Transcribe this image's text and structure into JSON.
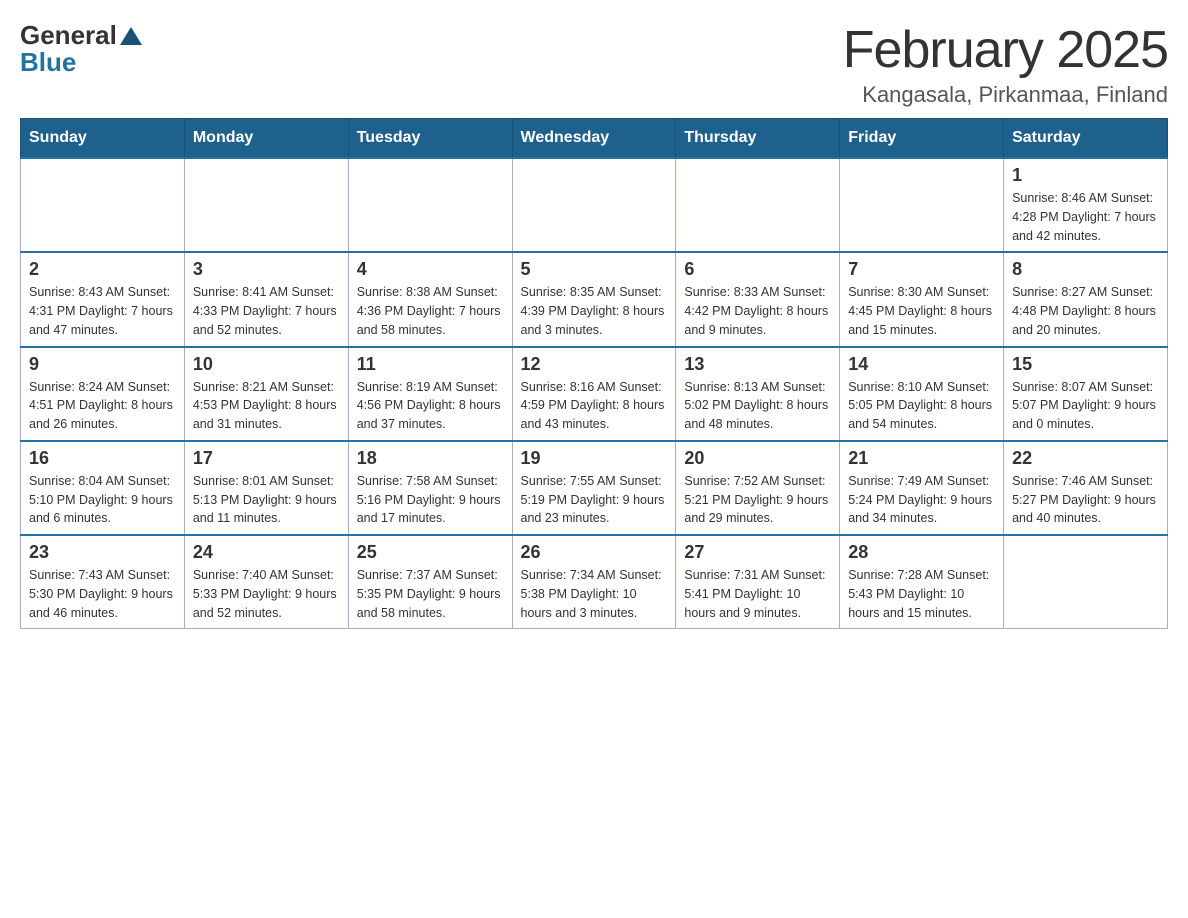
{
  "logo": {
    "general": "General",
    "triangle": "▲",
    "blue": "Blue"
  },
  "title": "February 2025",
  "location": "Kangasala, Pirkanmaa, Finland",
  "weekdays": [
    "Sunday",
    "Monday",
    "Tuesday",
    "Wednesday",
    "Thursday",
    "Friday",
    "Saturday"
  ],
  "weeks": [
    [
      {
        "day": "",
        "info": ""
      },
      {
        "day": "",
        "info": ""
      },
      {
        "day": "",
        "info": ""
      },
      {
        "day": "",
        "info": ""
      },
      {
        "day": "",
        "info": ""
      },
      {
        "day": "",
        "info": ""
      },
      {
        "day": "1",
        "info": "Sunrise: 8:46 AM\nSunset: 4:28 PM\nDaylight: 7 hours\nand 42 minutes."
      }
    ],
    [
      {
        "day": "2",
        "info": "Sunrise: 8:43 AM\nSunset: 4:31 PM\nDaylight: 7 hours\nand 47 minutes."
      },
      {
        "day": "3",
        "info": "Sunrise: 8:41 AM\nSunset: 4:33 PM\nDaylight: 7 hours\nand 52 minutes."
      },
      {
        "day": "4",
        "info": "Sunrise: 8:38 AM\nSunset: 4:36 PM\nDaylight: 7 hours\nand 58 minutes."
      },
      {
        "day": "5",
        "info": "Sunrise: 8:35 AM\nSunset: 4:39 PM\nDaylight: 8 hours\nand 3 minutes."
      },
      {
        "day": "6",
        "info": "Sunrise: 8:33 AM\nSunset: 4:42 PM\nDaylight: 8 hours\nand 9 minutes."
      },
      {
        "day": "7",
        "info": "Sunrise: 8:30 AM\nSunset: 4:45 PM\nDaylight: 8 hours\nand 15 minutes."
      },
      {
        "day": "8",
        "info": "Sunrise: 8:27 AM\nSunset: 4:48 PM\nDaylight: 8 hours\nand 20 minutes."
      }
    ],
    [
      {
        "day": "9",
        "info": "Sunrise: 8:24 AM\nSunset: 4:51 PM\nDaylight: 8 hours\nand 26 minutes."
      },
      {
        "day": "10",
        "info": "Sunrise: 8:21 AM\nSunset: 4:53 PM\nDaylight: 8 hours\nand 31 minutes."
      },
      {
        "day": "11",
        "info": "Sunrise: 8:19 AM\nSunset: 4:56 PM\nDaylight: 8 hours\nand 37 minutes."
      },
      {
        "day": "12",
        "info": "Sunrise: 8:16 AM\nSunset: 4:59 PM\nDaylight: 8 hours\nand 43 minutes."
      },
      {
        "day": "13",
        "info": "Sunrise: 8:13 AM\nSunset: 5:02 PM\nDaylight: 8 hours\nand 48 minutes."
      },
      {
        "day": "14",
        "info": "Sunrise: 8:10 AM\nSunset: 5:05 PM\nDaylight: 8 hours\nand 54 minutes."
      },
      {
        "day": "15",
        "info": "Sunrise: 8:07 AM\nSunset: 5:07 PM\nDaylight: 9 hours\nand 0 minutes."
      }
    ],
    [
      {
        "day": "16",
        "info": "Sunrise: 8:04 AM\nSunset: 5:10 PM\nDaylight: 9 hours\nand 6 minutes."
      },
      {
        "day": "17",
        "info": "Sunrise: 8:01 AM\nSunset: 5:13 PM\nDaylight: 9 hours\nand 11 minutes."
      },
      {
        "day": "18",
        "info": "Sunrise: 7:58 AM\nSunset: 5:16 PM\nDaylight: 9 hours\nand 17 minutes."
      },
      {
        "day": "19",
        "info": "Sunrise: 7:55 AM\nSunset: 5:19 PM\nDaylight: 9 hours\nand 23 minutes."
      },
      {
        "day": "20",
        "info": "Sunrise: 7:52 AM\nSunset: 5:21 PM\nDaylight: 9 hours\nand 29 minutes."
      },
      {
        "day": "21",
        "info": "Sunrise: 7:49 AM\nSunset: 5:24 PM\nDaylight: 9 hours\nand 34 minutes."
      },
      {
        "day": "22",
        "info": "Sunrise: 7:46 AM\nSunset: 5:27 PM\nDaylight: 9 hours\nand 40 minutes."
      }
    ],
    [
      {
        "day": "23",
        "info": "Sunrise: 7:43 AM\nSunset: 5:30 PM\nDaylight: 9 hours\nand 46 minutes."
      },
      {
        "day": "24",
        "info": "Sunrise: 7:40 AM\nSunset: 5:33 PM\nDaylight: 9 hours\nand 52 minutes."
      },
      {
        "day": "25",
        "info": "Sunrise: 7:37 AM\nSunset: 5:35 PM\nDaylight: 9 hours\nand 58 minutes."
      },
      {
        "day": "26",
        "info": "Sunrise: 7:34 AM\nSunset: 5:38 PM\nDaylight: 10 hours\nand 3 minutes."
      },
      {
        "day": "27",
        "info": "Sunrise: 7:31 AM\nSunset: 5:41 PM\nDaylight: 10 hours\nand 9 minutes."
      },
      {
        "day": "28",
        "info": "Sunrise: 7:28 AM\nSunset: 5:43 PM\nDaylight: 10 hours\nand 15 minutes."
      },
      {
        "day": "",
        "info": ""
      }
    ]
  ]
}
